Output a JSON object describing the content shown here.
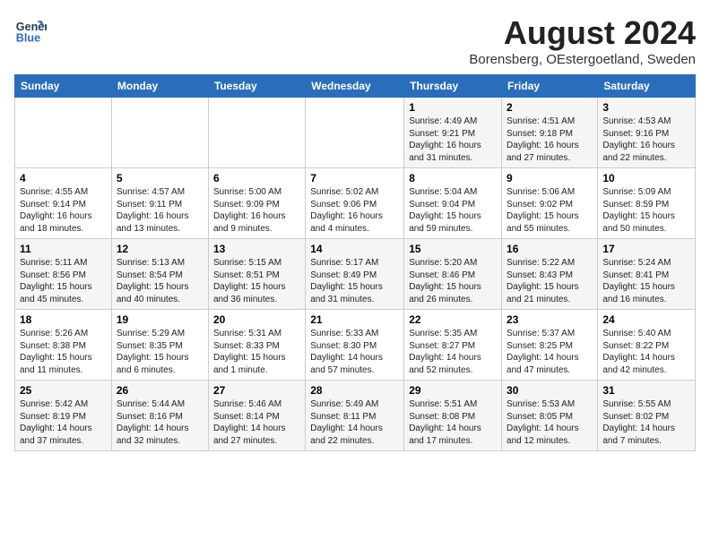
{
  "logo": {
    "line1": "General",
    "line2": "Blue"
  },
  "title": "August 2024",
  "subtitle": "Borensberg, OEstergoetland, Sweden",
  "weekdays": [
    "Sunday",
    "Monday",
    "Tuesday",
    "Wednesday",
    "Thursday",
    "Friday",
    "Saturday"
  ],
  "weeks": [
    [
      {
        "day": null
      },
      {
        "day": null
      },
      {
        "day": null
      },
      {
        "day": null
      },
      {
        "day": 1,
        "sunrise": "4:49 AM",
        "sunset": "9:21 PM",
        "daylight": "16 hours and 31 minutes."
      },
      {
        "day": 2,
        "sunrise": "4:51 AM",
        "sunset": "9:18 PM",
        "daylight": "16 hours and 27 minutes."
      },
      {
        "day": 3,
        "sunrise": "4:53 AM",
        "sunset": "9:16 PM",
        "daylight": "16 hours and 22 minutes."
      }
    ],
    [
      {
        "day": 4,
        "sunrise": "4:55 AM",
        "sunset": "9:14 PM",
        "daylight": "16 hours and 18 minutes."
      },
      {
        "day": 5,
        "sunrise": "4:57 AM",
        "sunset": "9:11 PM",
        "daylight": "16 hours and 13 minutes."
      },
      {
        "day": 6,
        "sunrise": "5:00 AM",
        "sunset": "9:09 PM",
        "daylight": "16 hours and 9 minutes."
      },
      {
        "day": 7,
        "sunrise": "5:02 AM",
        "sunset": "9:06 PM",
        "daylight": "16 hours and 4 minutes."
      },
      {
        "day": 8,
        "sunrise": "5:04 AM",
        "sunset": "9:04 PM",
        "daylight": "15 hours and 59 minutes."
      },
      {
        "day": 9,
        "sunrise": "5:06 AM",
        "sunset": "9:02 PM",
        "daylight": "15 hours and 55 minutes."
      },
      {
        "day": 10,
        "sunrise": "5:09 AM",
        "sunset": "8:59 PM",
        "daylight": "15 hours and 50 minutes."
      }
    ],
    [
      {
        "day": 11,
        "sunrise": "5:11 AM",
        "sunset": "8:56 PM",
        "daylight": "15 hours and 45 minutes."
      },
      {
        "day": 12,
        "sunrise": "5:13 AM",
        "sunset": "8:54 PM",
        "daylight": "15 hours and 40 minutes."
      },
      {
        "day": 13,
        "sunrise": "5:15 AM",
        "sunset": "8:51 PM",
        "daylight": "15 hours and 36 minutes."
      },
      {
        "day": 14,
        "sunrise": "5:17 AM",
        "sunset": "8:49 PM",
        "daylight": "15 hours and 31 minutes."
      },
      {
        "day": 15,
        "sunrise": "5:20 AM",
        "sunset": "8:46 PM",
        "daylight": "15 hours and 26 minutes."
      },
      {
        "day": 16,
        "sunrise": "5:22 AM",
        "sunset": "8:43 PM",
        "daylight": "15 hours and 21 minutes."
      },
      {
        "day": 17,
        "sunrise": "5:24 AM",
        "sunset": "8:41 PM",
        "daylight": "15 hours and 16 minutes."
      }
    ],
    [
      {
        "day": 18,
        "sunrise": "5:26 AM",
        "sunset": "8:38 PM",
        "daylight": "15 hours and 11 minutes."
      },
      {
        "day": 19,
        "sunrise": "5:29 AM",
        "sunset": "8:35 PM",
        "daylight": "15 hours and 6 minutes."
      },
      {
        "day": 20,
        "sunrise": "5:31 AM",
        "sunset": "8:33 PM",
        "daylight": "15 hours and 1 minute."
      },
      {
        "day": 21,
        "sunrise": "5:33 AM",
        "sunset": "8:30 PM",
        "daylight": "14 hours and 57 minutes."
      },
      {
        "day": 22,
        "sunrise": "5:35 AM",
        "sunset": "8:27 PM",
        "daylight": "14 hours and 52 minutes."
      },
      {
        "day": 23,
        "sunrise": "5:37 AM",
        "sunset": "8:25 PM",
        "daylight": "14 hours and 47 minutes."
      },
      {
        "day": 24,
        "sunrise": "5:40 AM",
        "sunset": "8:22 PM",
        "daylight": "14 hours and 42 minutes."
      }
    ],
    [
      {
        "day": 25,
        "sunrise": "5:42 AM",
        "sunset": "8:19 PM",
        "daylight": "14 hours and 37 minutes."
      },
      {
        "day": 26,
        "sunrise": "5:44 AM",
        "sunset": "8:16 PM",
        "daylight": "14 hours and 32 minutes."
      },
      {
        "day": 27,
        "sunrise": "5:46 AM",
        "sunset": "8:14 PM",
        "daylight": "14 hours and 27 minutes."
      },
      {
        "day": 28,
        "sunrise": "5:49 AM",
        "sunset": "8:11 PM",
        "daylight": "14 hours and 22 minutes."
      },
      {
        "day": 29,
        "sunrise": "5:51 AM",
        "sunset": "8:08 PM",
        "daylight": "14 hours and 17 minutes."
      },
      {
        "day": 30,
        "sunrise": "5:53 AM",
        "sunset": "8:05 PM",
        "daylight": "14 hours and 12 minutes."
      },
      {
        "day": 31,
        "sunrise": "5:55 AM",
        "sunset": "8:02 PM",
        "daylight": "14 hours and 7 minutes."
      }
    ]
  ]
}
